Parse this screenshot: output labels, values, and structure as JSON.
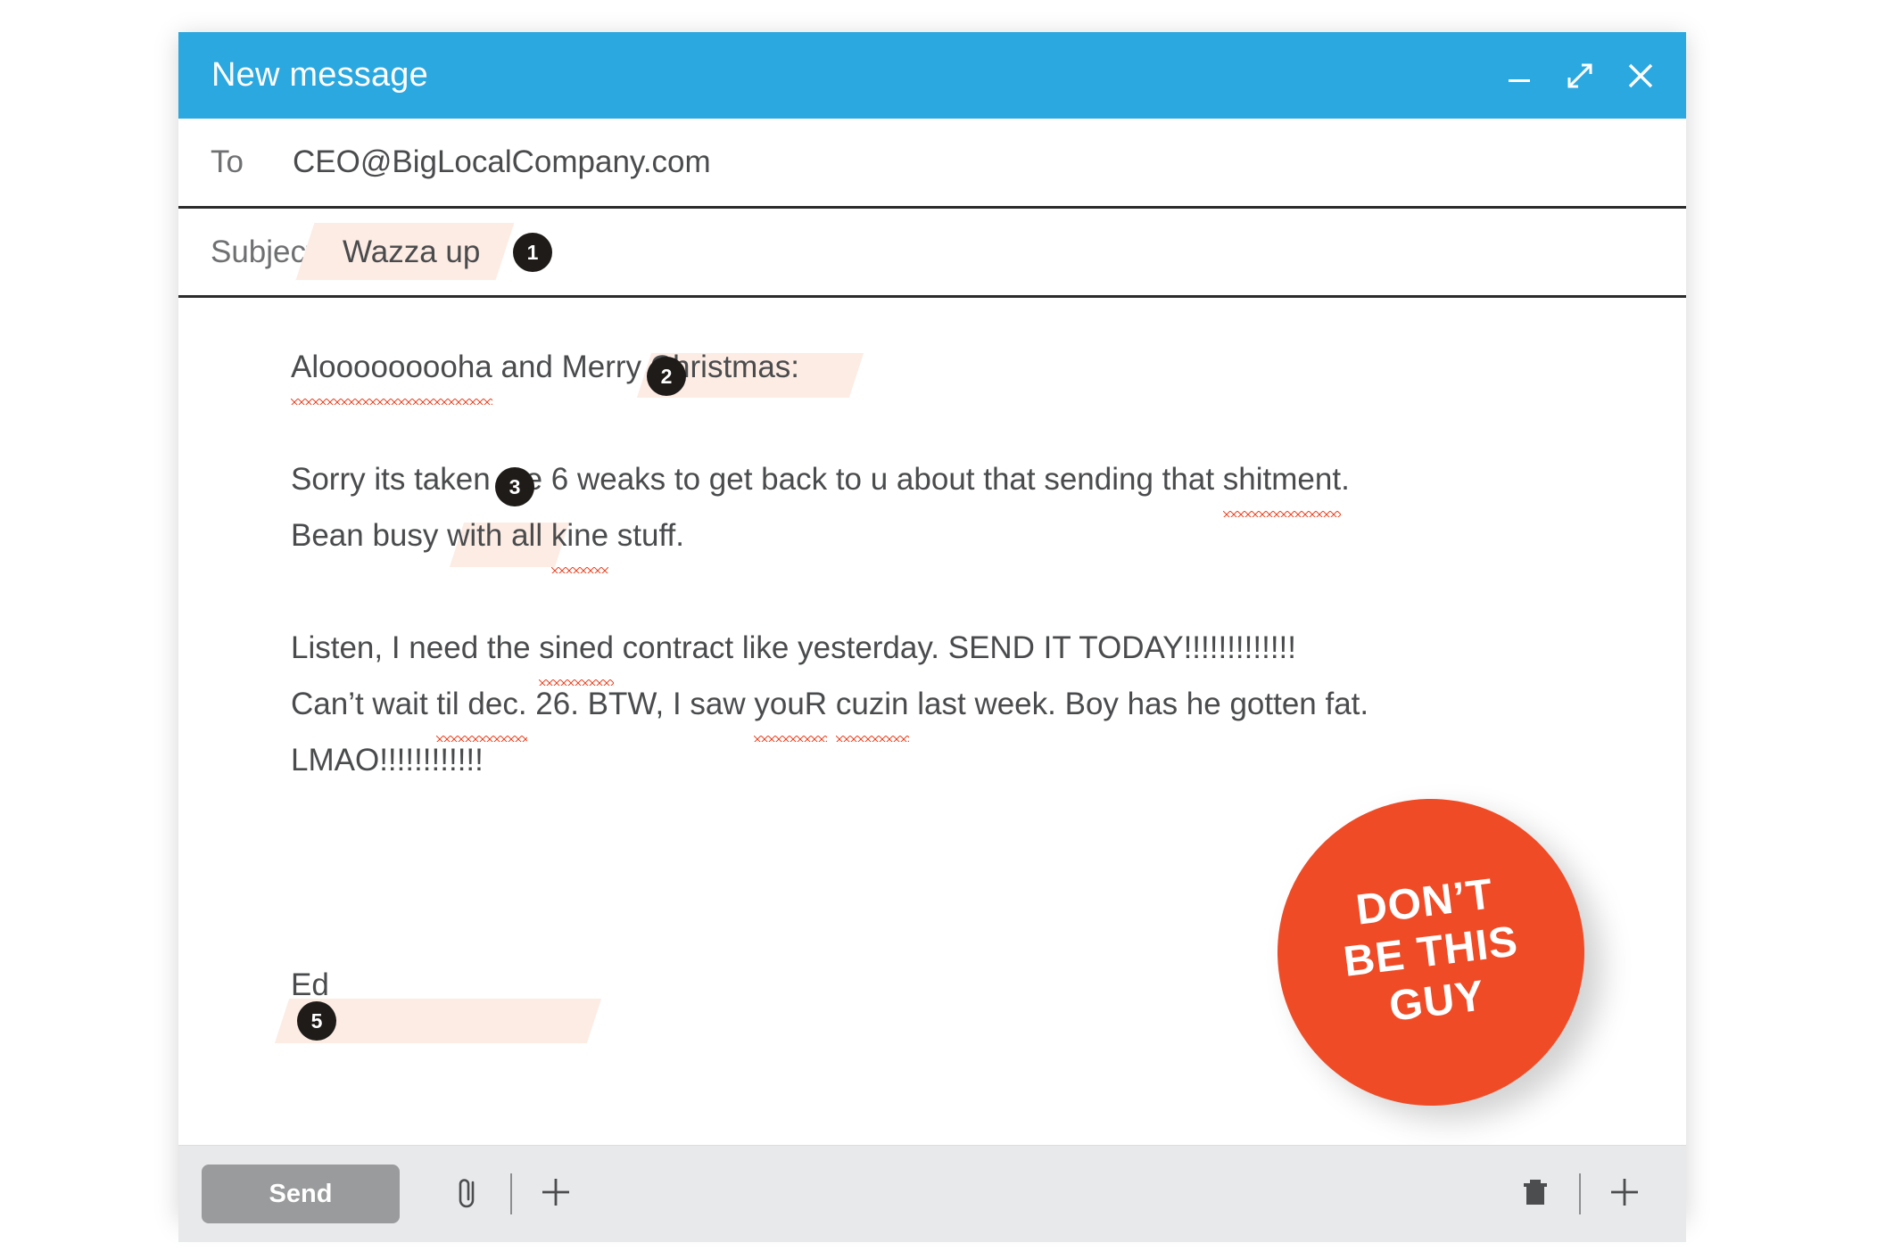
{
  "window": {
    "title": "New message",
    "controls": [
      {
        "name": "minimize",
        "icon": "minimize-icon"
      },
      {
        "name": "expand",
        "icon": "expand-icon"
      },
      {
        "name": "close",
        "icon": "close-icon"
      }
    ]
  },
  "fields": {
    "to_label": "To",
    "to_value": "CEO@BigLocalCompany.com",
    "subject_label": "Subject",
    "subject_value": "Wazza up"
  },
  "body": {
    "line_greeting_a": "Alooooooooha",
    "line_greeting_b": " and Merry Christmas:",
    "line2_a": "Sorry its taken me 6 weaks to get back to u about that sending that ",
    "line2_b": "shitment",
    "line2_c": ".",
    "line3_a": "Bean busy with all ",
    "line3_b": "kine",
    "line3_c": " stuff.",
    "line4_a": "Listen, I need the ",
    "line4_b": "sined",
    "line4_c": " contract like yesterday. SEND IT TODAY!!!!!!!!!!!!!",
    "line5_a": "Can’t wait ",
    "line5_b": "til dec.",
    "line5_c": " 26. BTW, I saw ",
    "line5_d": "youR",
    "line5_e": " ",
    "line5_f": "cuzin",
    "line5_g": " last week. Boy has he gotten fat.",
    "line6": "LMAO!!!!!!!!!!!!",
    "signature": "Ed"
  },
  "annotations": {
    "badge1": "1",
    "badge2": "2",
    "badge3": "3",
    "badge5": "5"
  },
  "sticker": {
    "line1": "DON’T",
    "line2": "BE THIS",
    "line3": "GUY"
  },
  "toolbar": {
    "send_label": "Send",
    "attach_icon": "paperclip-icon",
    "add_icon": "plus-icon",
    "delete_icon": "trash-icon",
    "more_icon": "plus-icon"
  },
  "colors": {
    "header_blue": "#2ba8e0",
    "highlight_pink": "#fcece4",
    "badge_black": "#1e1b18",
    "sticker_orange": "#ef4b26",
    "spellcheck_red": "#ef4a2a",
    "toolbar_grey": "#e8e9ea",
    "send_grey": "#9a9b9d"
  }
}
